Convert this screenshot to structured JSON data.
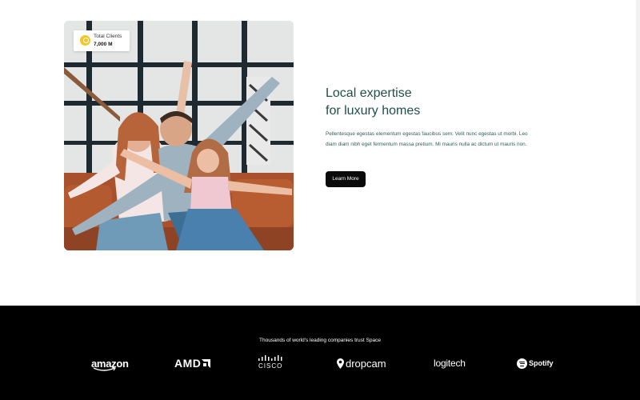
{
  "hero": {
    "stat_card": {
      "label": "Total Clients",
      "value": "7,000 M",
      "icon": "clients-icon",
      "icon_color": "#f3c623"
    },
    "headline_line1": "Local expertise",
    "headline_line2": "for luxury homes",
    "body": "Pellentesque egestas elementum egestas faucibus sem. Velit nunc egestas ut morbi. Leo diam diam nibh eget fermentum massa pretium. Mi mauris nulla ac dictum ut mauris non.",
    "cta_label": "Learn More",
    "headline_color": "#1f4e4a"
  },
  "footer": {
    "trust_text": "Thousands of world's leading companies trust Space",
    "logos": [
      {
        "name": "amazon",
        "text": "amazon"
      },
      {
        "name": "amd",
        "text": "AMD"
      },
      {
        "name": "cisco",
        "text": "CISCO"
      },
      {
        "name": "dropcam",
        "text": "dropcam"
      },
      {
        "name": "logitech",
        "text": "logitech"
      },
      {
        "name": "spotify",
        "text": "Spotify"
      }
    ],
    "background": "#000000"
  }
}
